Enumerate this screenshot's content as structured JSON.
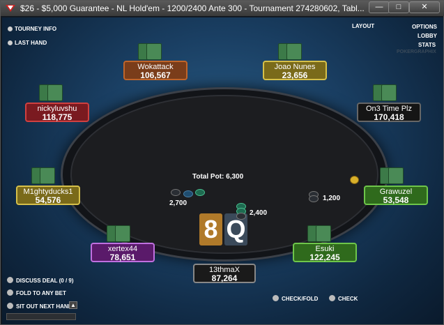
{
  "window": {
    "title": "$26 - $5,000 Guarantee - NL Hold'em - 1200/2400 Ante 300 - Tournament 274280602, Tabl...",
    "minimize_label": "—",
    "maximize_label": "□",
    "close_label": "✕"
  },
  "top_left": {
    "tourney_info": "TOURNEY INFO",
    "last_hand": "LAST HAND"
  },
  "top_right": {
    "layout": "LAYOUT",
    "options": "OPTIONS",
    "lobby": "LOBBY",
    "stats": "STATS",
    "brand": "POKERGRAPHIX"
  },
  "players": [
    {
      "name": "Wokattack",
      "stack": "106,567",
      "color": "brown"
    },
    {
      "name": "Joao Nunes",
      "stack": "23,656",
      "color": "gold"
    },
    {
      "name": "nickyluvshu",
      "stack": "118,775",
      "color": "red"
    },
    {
      "name": "On3 Time Plz",
      "stack": "170,418",
      "color": "black"
    },
    {
      "name": "M1ghtyducks1",
      "stack": "54,576",
      "color": "gold"
    },
    {
      "name": "Grawuzel",
      "stack": "53,548",
      "color": "green"
    },
    {
      "name": "xertex44",
      "stack": "78,651",
      "color": "purple"
    },
    {
      "name": "Esuki",
      "stack": "122,245",
      "color": "green"
    },
    {
      "name": "13thmaX",
      "stack": "87,264",
      "color": "hero"
    }
  ],
  "hero_cards": [
    "8",
    "Q"
  ],
  "pot": "Total Pot: 6,300",
  "bets": {
    "left": "2,700",
    "center": "2,400",
    "right": "1,200"
  },
  "bottom_options": {
    "discuss_deal": "DISCUSS DEAL (0  /  9)",
    "fold_to_any_bet": "FOLD TO ANY BET",
    "sit_out_next_hand": "SIT OUT NEXT HAND"
  },
  "action_options": {
    "check_fold": "CHECK/FOLD",
    "check": "CHECK"
  }
}
